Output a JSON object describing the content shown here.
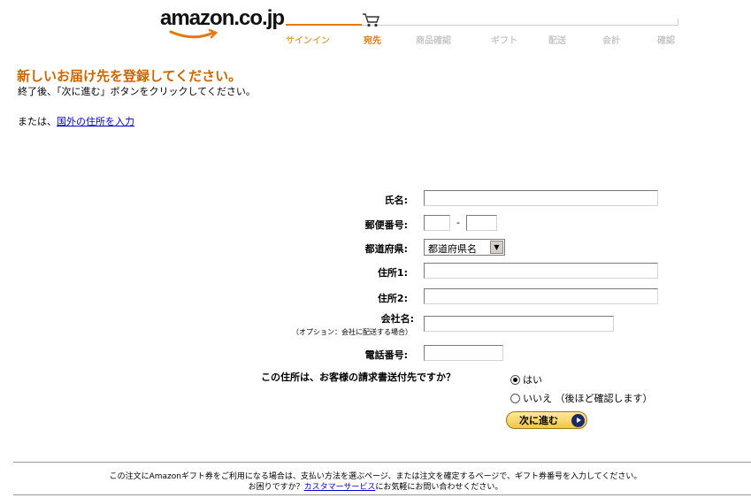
{
  "header": {
    "logo_text": "amazon.co.jp",
    "steps": [
      {
        "label": "サインイン",
        "state": "done"
      },
      {
        "label": "宛先",
        "state": "current"
      },
      {
        "label": "商品確認",
        "state": "todo"
      },
      {
        "label": "ギフト",
        "state": "todo"
      },
      {
        "label": "配送",
        "state": "todo"
      },
      {
        "label": "会計",
        "state": "todo"
      },
      {
        "label": "確認",
        "state": "todo"
      }
    ]
  },
  "page": {
    "title": "新しいお届け先を登録してください。",
    "instruction": "終了後、「次に進む」ボタンをクリックしてください。",
    "alt_prefix": "または、",
    "alt_link": "国外の住所を入力"
  },
  "form": {
    "name_label": "氏名:",
    "name_value": "",
    "postal_label": "郵便番号:",
    "postal1_value": "",
    "postal_dash": "-",
    "postal2_value": "",
    "prefecture_label": "都道府県:",
    "prefecture_selected": "都道府県名",
    "address1_label": "住所1:",
    "address1_value": "",
    "address2_label": "住所2:",
    "address2_value": "",
    "company_label": "会社名:",
    "company_note": "（オプション：会社に配送する場合）",
    "company_value": "",
    "phone_label": "電話番号:",
    "phone_value": "",
    "billing_question": "この住所は、お客様の請求書送付先ですか？",
    "billing_yes": "はい",
    "billing_no": "いいえ （後ほど確認します）",
    "billing_selected": "yes",
    "next_button": "次に進む"
  },
  "footer": {
    "line1": "この注文にAmazonギフト券をご利用になる場合は、支払い方法を選ぶページ、または注文を確定するページで、ギフト券番号を入力してください。",
    "line2_prefix": "お困りですか？",
    "line2_link": "カスタマーサービス",
    "line2_suffix": "にお気軽にお問い合わせください。"
  },
  "colors": {
    "accent": "#e47911",
    "title": "#cc6600",
    "link": "#0000cc",
    "button": "#f5c442"
  }
}
